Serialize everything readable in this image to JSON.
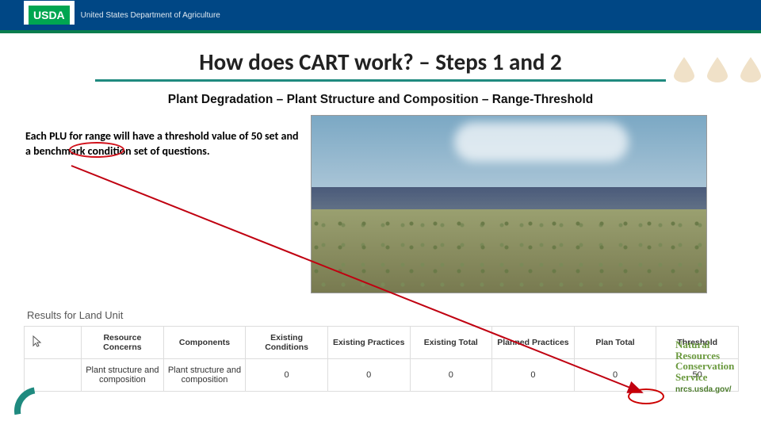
{
  "header": {
    "logo_text": "USDA",
    "org_name": "United States Department of Agriculture"
  },
  "title": "How does CART work? – Steps 1 and 2",
  "subtitle": "Plant Degradation – Plant Structure and Composition – Range-Threshold",
  "left_paragraph": "Each PLU for range will have a threshold value of 50 set and a benchmark condition set of questions.",
  "annotation_value": "50",
  "results_label": "Results for Land Unit",
  "table": {
    "headers": [
      "",
      "Resource Concerns",
      "Components",
      "Existing Conditions",
      "Existing Practices",
      "Existing Total",
      "Planned Practices",
      "Plan Total",
      "Threshold"
    ],
    "row": {
      "resource_concerns": "Plant structure and composition",
      "components": "Plant structure and composition",
      "existing_conditions": "0",
      "existing_practices": "0",
      "existing_total": "0",
      "planned_practices": "0",
      "plan_total": "0",
      "threshold": "50"
    }
  },
  "nrcs": {
    "line1": "Natural",
    "line2": "Resources",
    "line3": "Conservation",
    "line4": "Service",
    "url": "nrcs.usda.gov/"
  }
}
